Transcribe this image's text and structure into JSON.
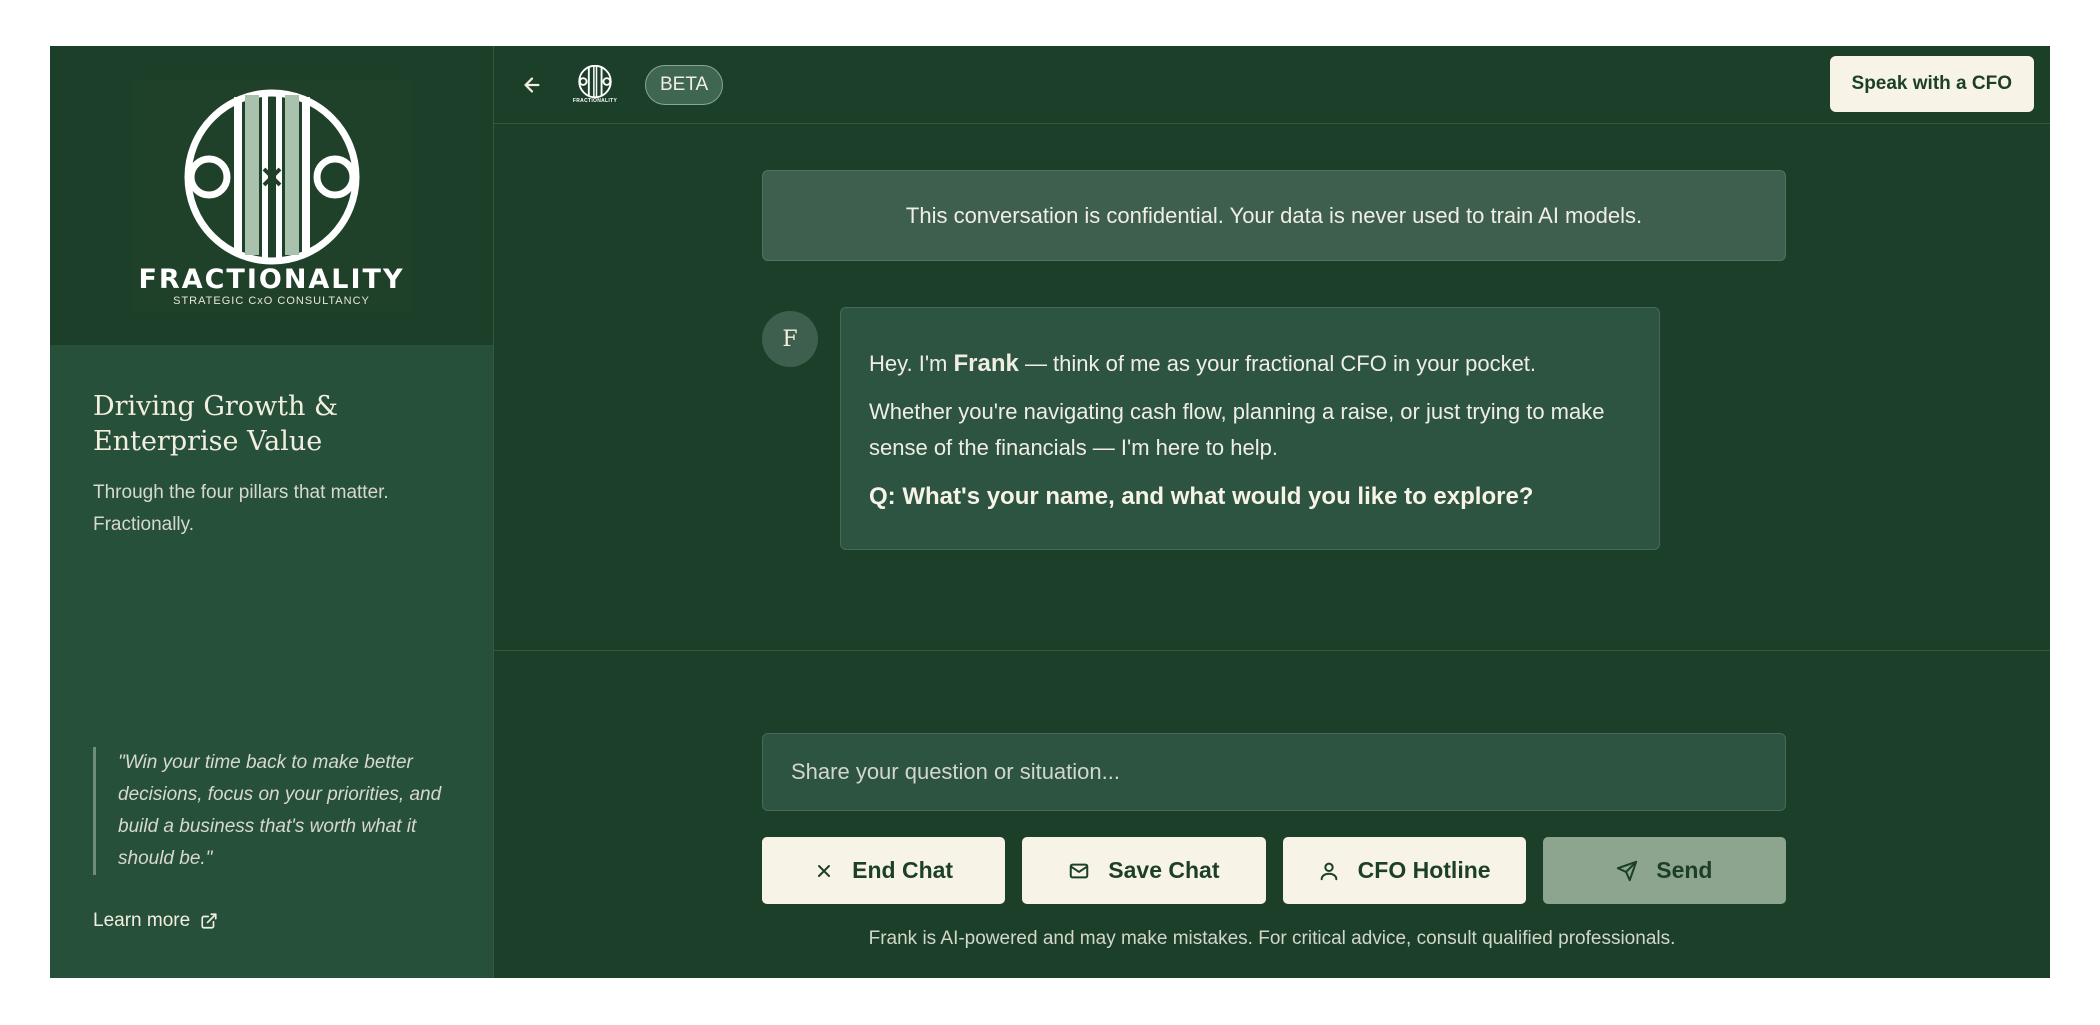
{
  "sidebar": {
    "logo": {
      "brand": "FRACTIONALITY",
      "tagline": "STRATEGIC CxO CONSULTANCY"
    },
    "title_line1": "Driving Growth &",
    "title_line2": "Enterprise Value",
    "subtitle": "Through the four pillars that matter. Fractionally.",
    "quote": "\"Win your time back to make better decisions, focus on your priorities, and build a business that's worth what it should be.\"",
    "learn_more": "Learn more"
  },
  "header": {
    "mini_logo_text": "FRACTIONALITY",
    "badge": "BETA",
    "cta": "Speak with a CFO"
  },
  "chat": {
    "notice": "This conversation is confidential. Your data is never used to train AI models.",
    "avatar_letter": "F",
    "message": {
      "greeting_prefix": "Hey. I'm ",
      "name": "Frank",
      "greeting_suffix": " — think of me as your fractional CFO in your pocket.",
      "paragraph": "Whether you're navigating cash flow, planning a raise, or just trying to make sense of the financials — I'm here to help.",
      "question": "Q: What's your name, and what would you like to explore?"
    }
  },
  "composer": {
    "placeholder": "Share your question or situation...",
    "buttons": {
      "end": "End Chat",
      "save": "Save Chat",
      "hotline": "CFO Hotline",
      "send": "Send"
    },
    "disclaimer": "Frank is AI-powered and may make mistakes. For critical advice, consult qualified professionals."
  },
  "colors": {
    "background": "#1b3f28",
    "sidebar": "#27503a",
    "cream": "#f7f4e7",
    "send_disabled": "#8da48f"
  }
}
